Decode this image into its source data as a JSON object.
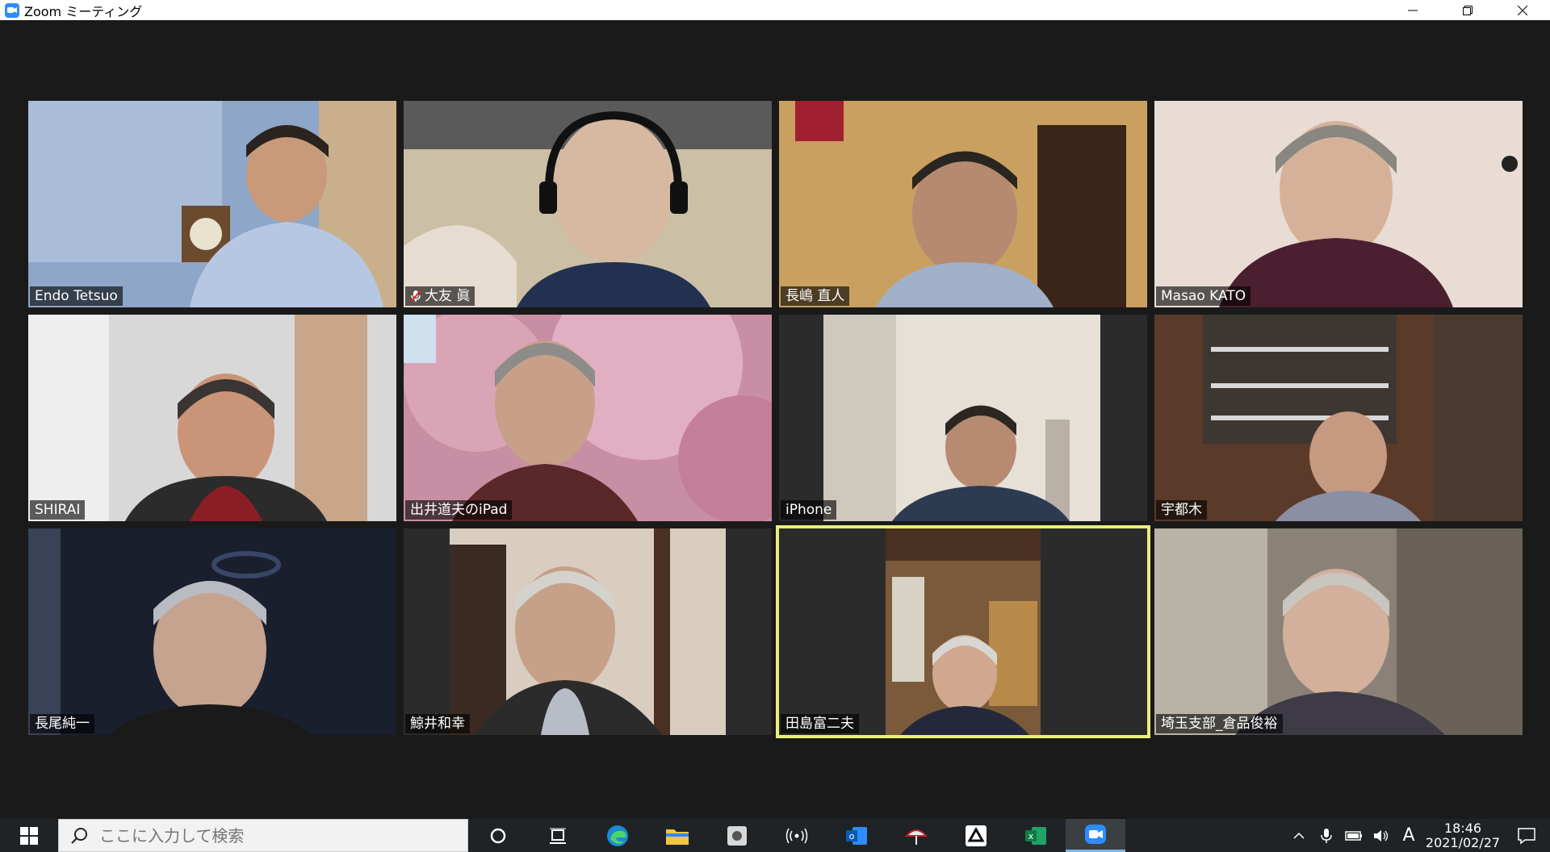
{
  "window": {
    "title": "Zoom ミーティング"
  },
  "participants": [
    {
      "name": "Endo Tetsuo",
      "muted": false
    },
    {
      "name": "大友 眞",
      "muted": true
    },
    {
      "name": "長嶋 直人",
      "muted": false
    },
    {
      "name": "Masao KATO",
      "muted": false
    },
    {
      "name": "SHIRAI",
      "muted": false
    },
    {
      "name": "出井道夫のiPad",
      "muted": false
    },
    {
      "name": "iPhone",
      "muted": false
    },
    {
      "name": "宇都木",
      "muted": false
    },
    {
      "name": "長尾純一",
      "muted": false
    },
    {
      "name": "鯨井和幸",
      "muted": false
    },
    {
      "name": "田島富二夫",
      "muted": false,
      "active_speaker": true
    },
    {
      "name": "埼玉支部_倉品俊裕",
      "muted": false
    }
  ],
  "taskbar": {
    "search_placeholder": "ここに入力して検索",
    "ime_indicator": "A",
    "time": "18:46",
    "date": "2021/02/27"
  },
  "colors": {
    "active_speaker_border": "#e8ef7a",
    "zoom_blue": "#2d8cff",
    "mute_red": "#e02020"
  }
}
